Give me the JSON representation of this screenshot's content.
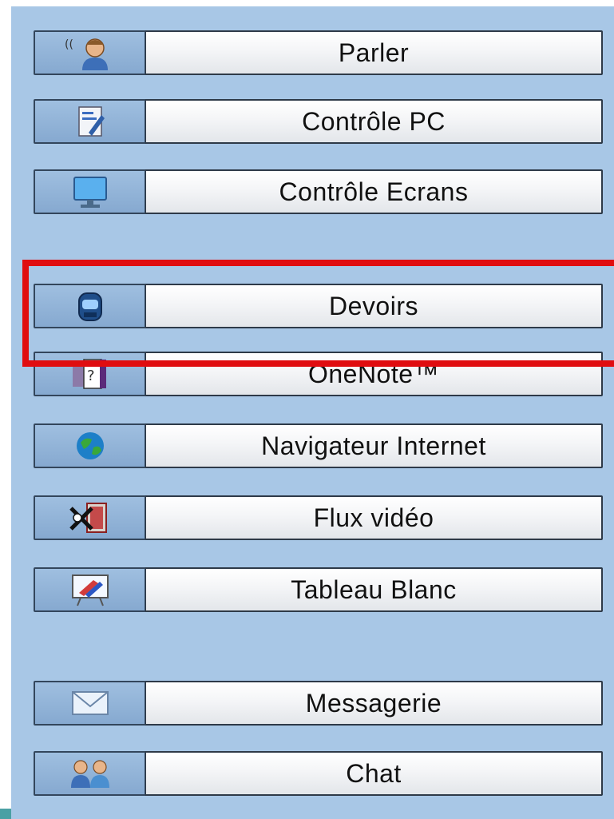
{
  "buttons": [
    {
      "label": "Parler",
      "icon": "speaking-person-icon"
    },
    {
      "label": "Contrôle PC",
      "icon": "document-pen-icon"
    },
    {
      "label": "Contrôle Ecrans",
      "icon": "monitor-icon"
    },
    {
      "label": "Devoirs",
      "icon": "homework-case-icon"
    },
    {
      "label": "OneNote™",
      "icon": "onenote-icon"
    },
    {
      "label": "Navigateur Internet",
      "icon": "globe-icon"
    },
    {
      "label": "Flux vidéo",
      "icon": "video-stream-icon"
    },
    {
      "label": "Tableau Blanc",
      "icon": "whiteboard-icon"
    },
    {
      "label": "Messagerie",
      "icon": "envelope-icon"
    },
    {
      "label": "Chat",
      "icon": "chat-users-icon"
    }
  ],
  "colors": {
    "panel_bg": "#a8c7e6",
    "highlight": "#e00d10"
  }
}
